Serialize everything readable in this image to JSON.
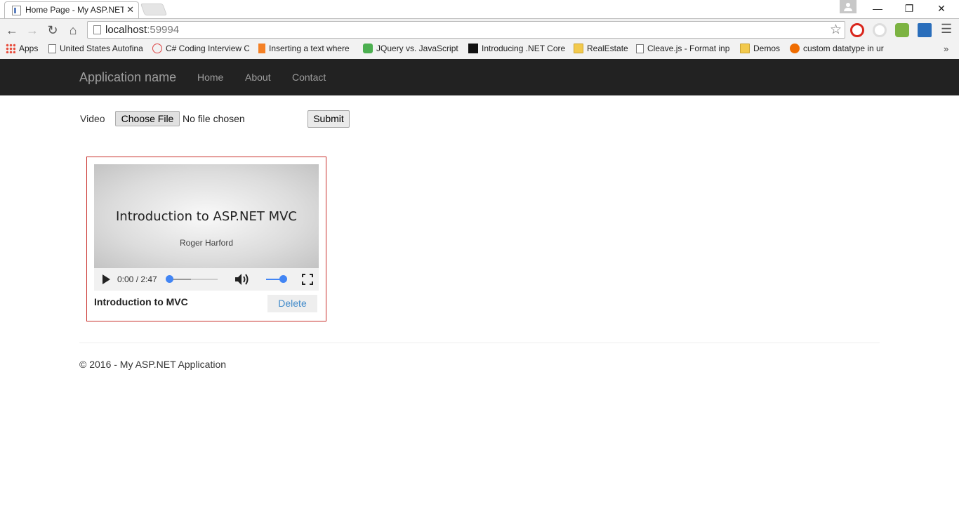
{
  "browser": {
    "tab_title": "Home Page - My ASP.NET",
    "url_host": "localhost",
    "url_port": ":59994",
    "bookmarks": [
      {
        "label": "Apps",
        "icon": "apps-grid-icon"
      },
      {
        "label": "United States Autofina",
        "icon": "page-icon"
      },
      {
        "label": "C# Coding Interview C",
        "icon": "badge-icon"
      },
      {
        "label": "Inserting a text where",
        "icon": "stackoverflow-icon"
      },
      {
        "label": "JQuery vs. JavaScript:",
        "icon": "u-icon"
      },
      {
        "label": "Introducing .NET Core",
        "icon": "m-icon"
      },
      {
        "label": "RealEstate",
        "icon": "folder-icon"
      },
      {
        "label": "Cleave.js - Format inp",
        "icon": "page-icon"
      },
      {
        "label": "Demos",
        "icon": "folder-icon"
      },
      {
        "label": "custom datatype in ur",
        "icon": "heart-icon"
      }
    ]
  },
  "navbar": {
    "brand": "Application name",
    "links": [
      "Home",
      "About",
      "Contact"
    ]
  },
  "upload": {
    "label": "Video",
    "choose_label": "Choose File",
    "file_status": "No file chosen",
    "submit_label": "Submit"
  },
  "video_card": {
    "slide_title": "Introduction to ASP.NET MVC",
    "slide_subtitle": "Roger Harford",
    "time": "0:00 / 2:47",
    "buffered_fraction": 0.45,
    "playback_fraction": 0,
    "volume_fraction": 1,
    "title": "Introduction to MVC",
    "delete_label": "Delete"
  },
  "footer": {
    "text": "© 2016 - My ASP.NET Application"
  },
  "colors": {
    "navbar_bg": "#222222",
    "card_border": "#c9302c",
    "link_blue": "#428bca",
    "accent_blue": "#4285f4"
  }
}
